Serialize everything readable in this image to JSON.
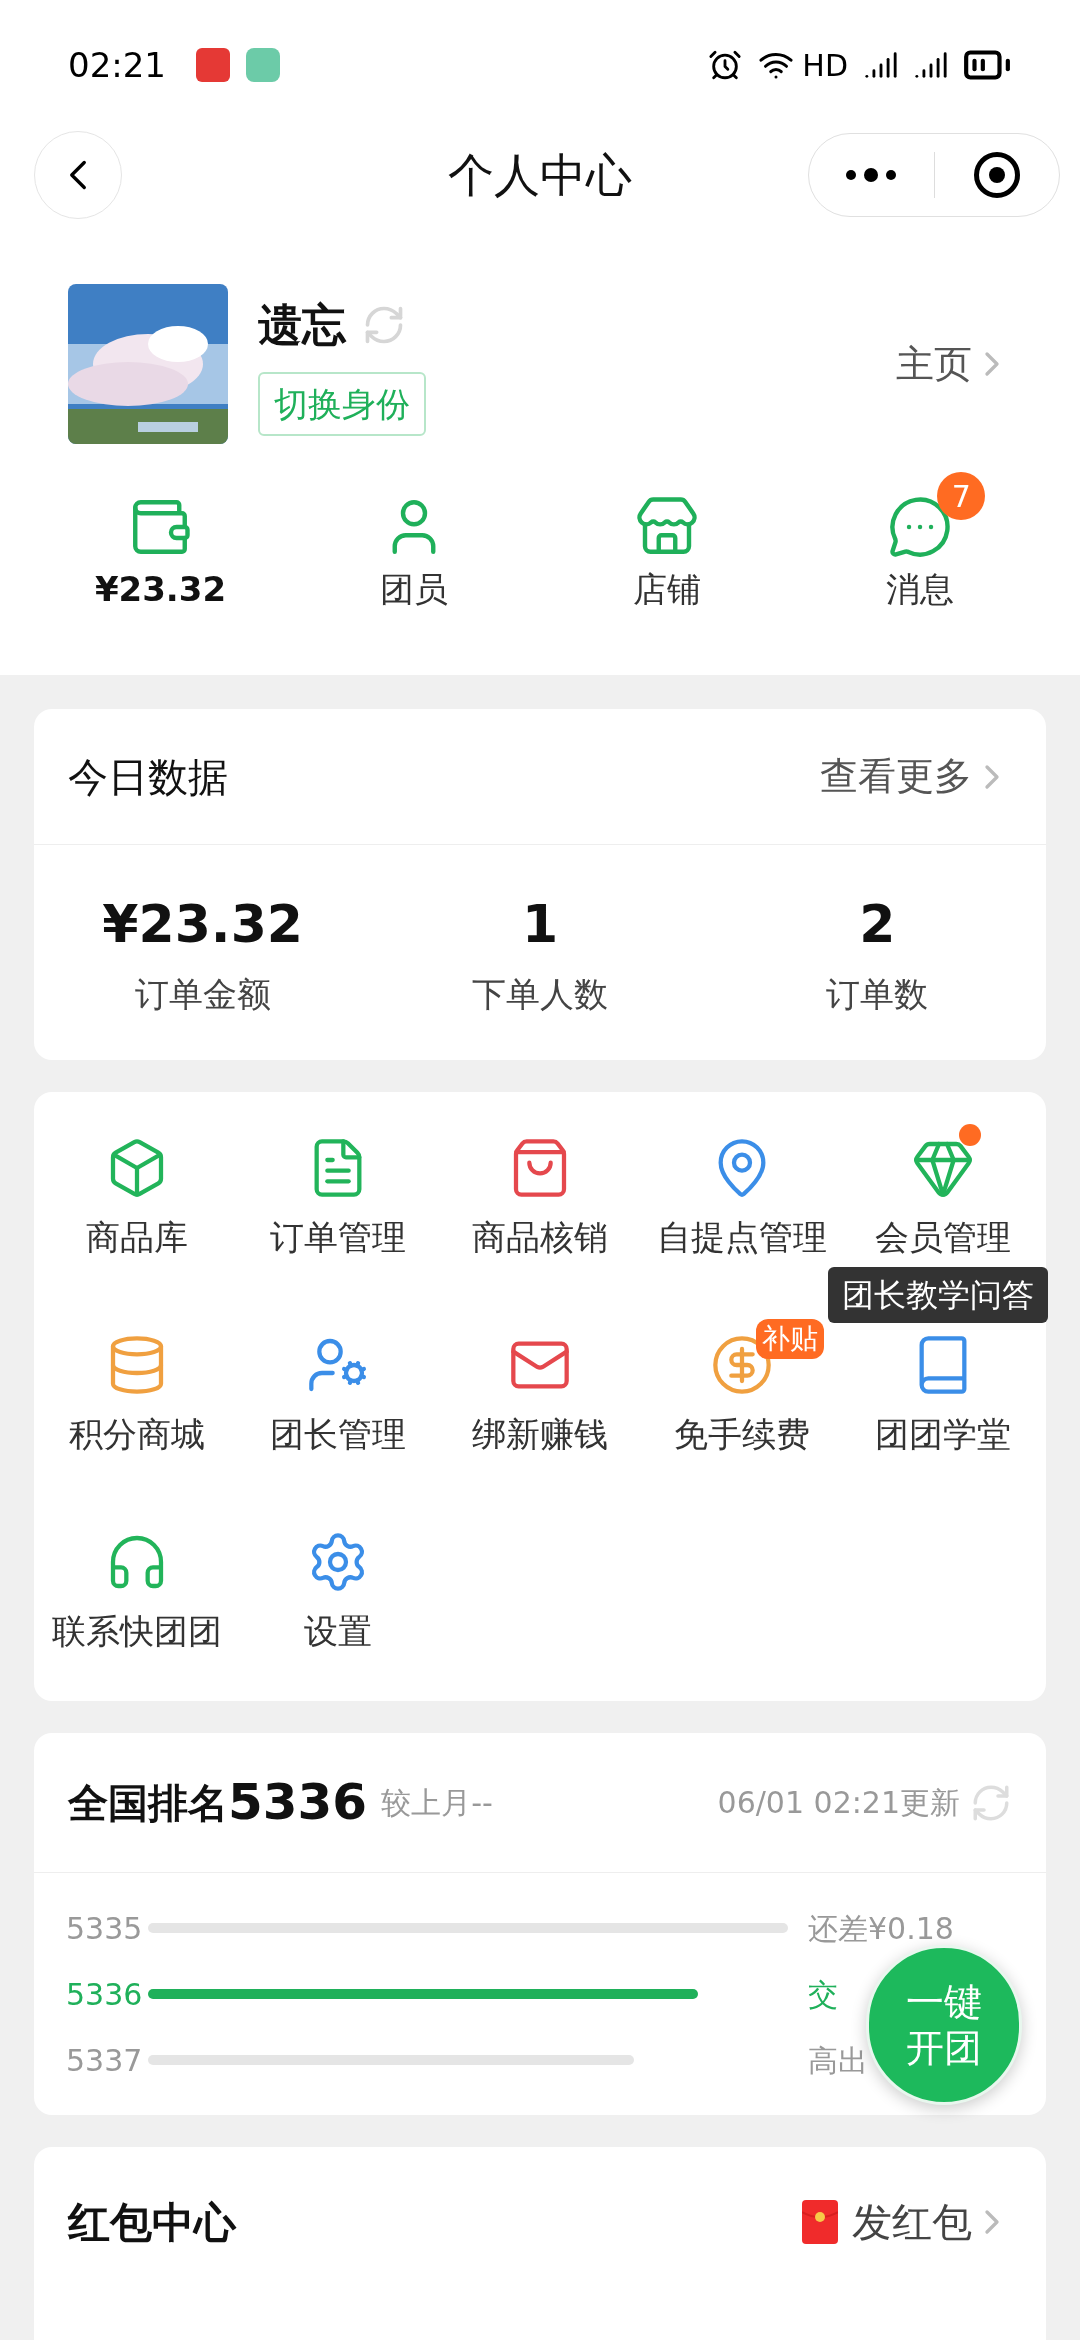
{
  "status_bar": {
    "time": "02:21",
    "network": "HD"
  },
  "nav": {
    "title": "个人中心"
  },
  "profile": {
    "name": "遗忘",
    "switch_label": "切换身份",
    "home_link": "主页"
  },
  "shortcuts": [
    {
      "label": "¥23.32",
      "kind": "amount"
    },
    {
      "label": "团员",
      "kind": "label"
    },
    {
      "label": "店铺",
      "kind": "label"
    },
    {
      "label": "消息",
      "kind": "label",
      "badge": "7"
    }
  ],
  "today": {
    "title": "今日数据",
    "more": "查看更多",
    "stats": [
      {
        "value": "¥23.32",
        "label": "订单金额"
      },
      {
        "value": "1",
        "label": "下单人数"
      },
      {
        "value": "2",
        "label": "订单数"
      }
    ]
  },
  "tools": [
    {
      "label": "商品库",
      "dot": false
    },
    {
      "label": "订单管理",
      "dot": false
    },
    {
      "label": "商品核销",
      "dot": false
    },
    {
      "label": "自提点管理",
      "dot": false
    },
    {
      "label": "会员管理",
      "dot": true
    },
    {
      "label": "积分商城",
      "dot": false
    },
    {
      "label": "团长管理",
      "dot": false
    },
    {
      "label": "绑新赚钱",
      "dot": false
    },
    {
      "label": "免手续费",
      "dot": false,
      "badge": "补贴"
    },
    {
      "label": "团团学堂",
      "dot": false,
      "tooltip": "团长教学问答"
    },
    {
      "label": "联系快团团",
      "dot": false
    },
    {
      "label": "设置",
      "dot": false
    }
  ],
  "ranking": {
    "title": "全国排名",
    "rank": "5336",
    "compare": "较上月--",
    "updated": "06/01 02:21更新",
    "rows": [
      {
        "rank": "5335",
        "selected": false,
        "note": "还差¥0.18"
      },
      {
        "rank": "5336",
        "selected": true,
        "note": "交"
      },
      {
        "rank": "5337",
        "selected": false,
        "note": "高出"
      }
    ]
  },
  "fab": {
    "line1": "一键",
    "line2": "开团"
  },
  "red_packet": {
    "title": "红包中心",
    "action": "发红包"
  }
}
